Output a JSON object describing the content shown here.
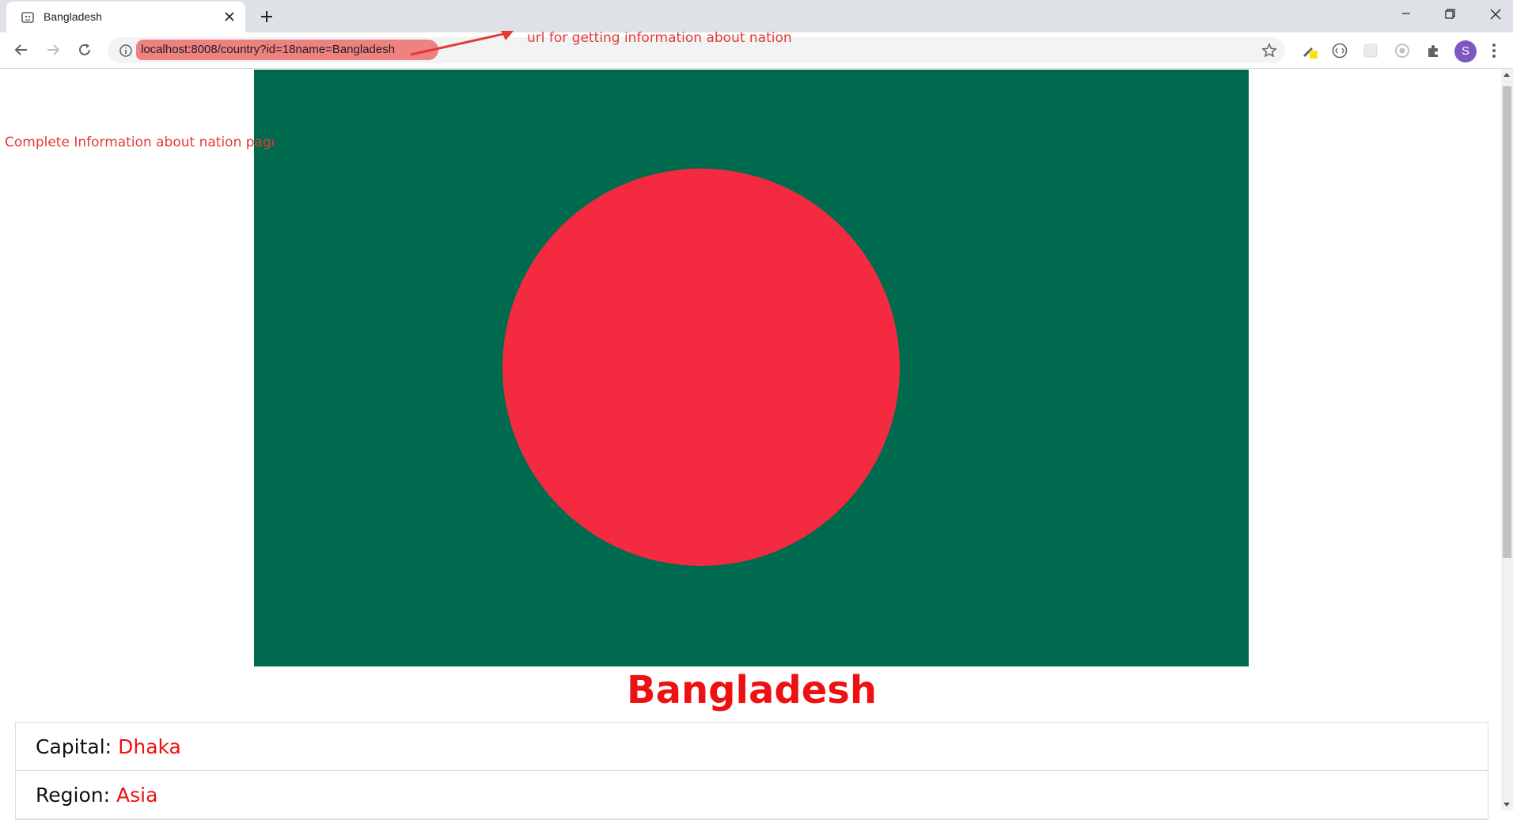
{
  "browser": {
    "tab": {
      "title": "Bangladesh"
    },
    "url": "localhost:8008/country?id=18name=Bangladesh",
    "profile_initial": "S",
    "icons": [
      "favicon-icon",
      "close-icon",
      "plus-icon",
      "minimize-icon",
      "restore-icon",
      "window-close-icon",
      "back-icon",
      "forward-icon",
      "reload-icon",
      "info-icon",
      "star-icon",
      "eyedropper-icon",
      "extension-icon",
      "puzzle-icon",
      "menu-icon"
    ]
  },
  "annotations": {
    "url_note": "url for getting information  about nation",
    "page_note": "Complete Information about nation page"
  },
  "country": {
    "name": "Bangladesh",
    "details": [
      {
        "label": "Capital:",
        "value": "Dhaka"
      },
      {
        "label": "Region:",
        "value": "Asia"
      }
    ]
  },
  "colors": {
    "flag_green": "#006a4e",
    "flag_red": "#f42a41",
    "accent_red": "#ee1111",
    "annotation_red": "#e53935"
  }
}
